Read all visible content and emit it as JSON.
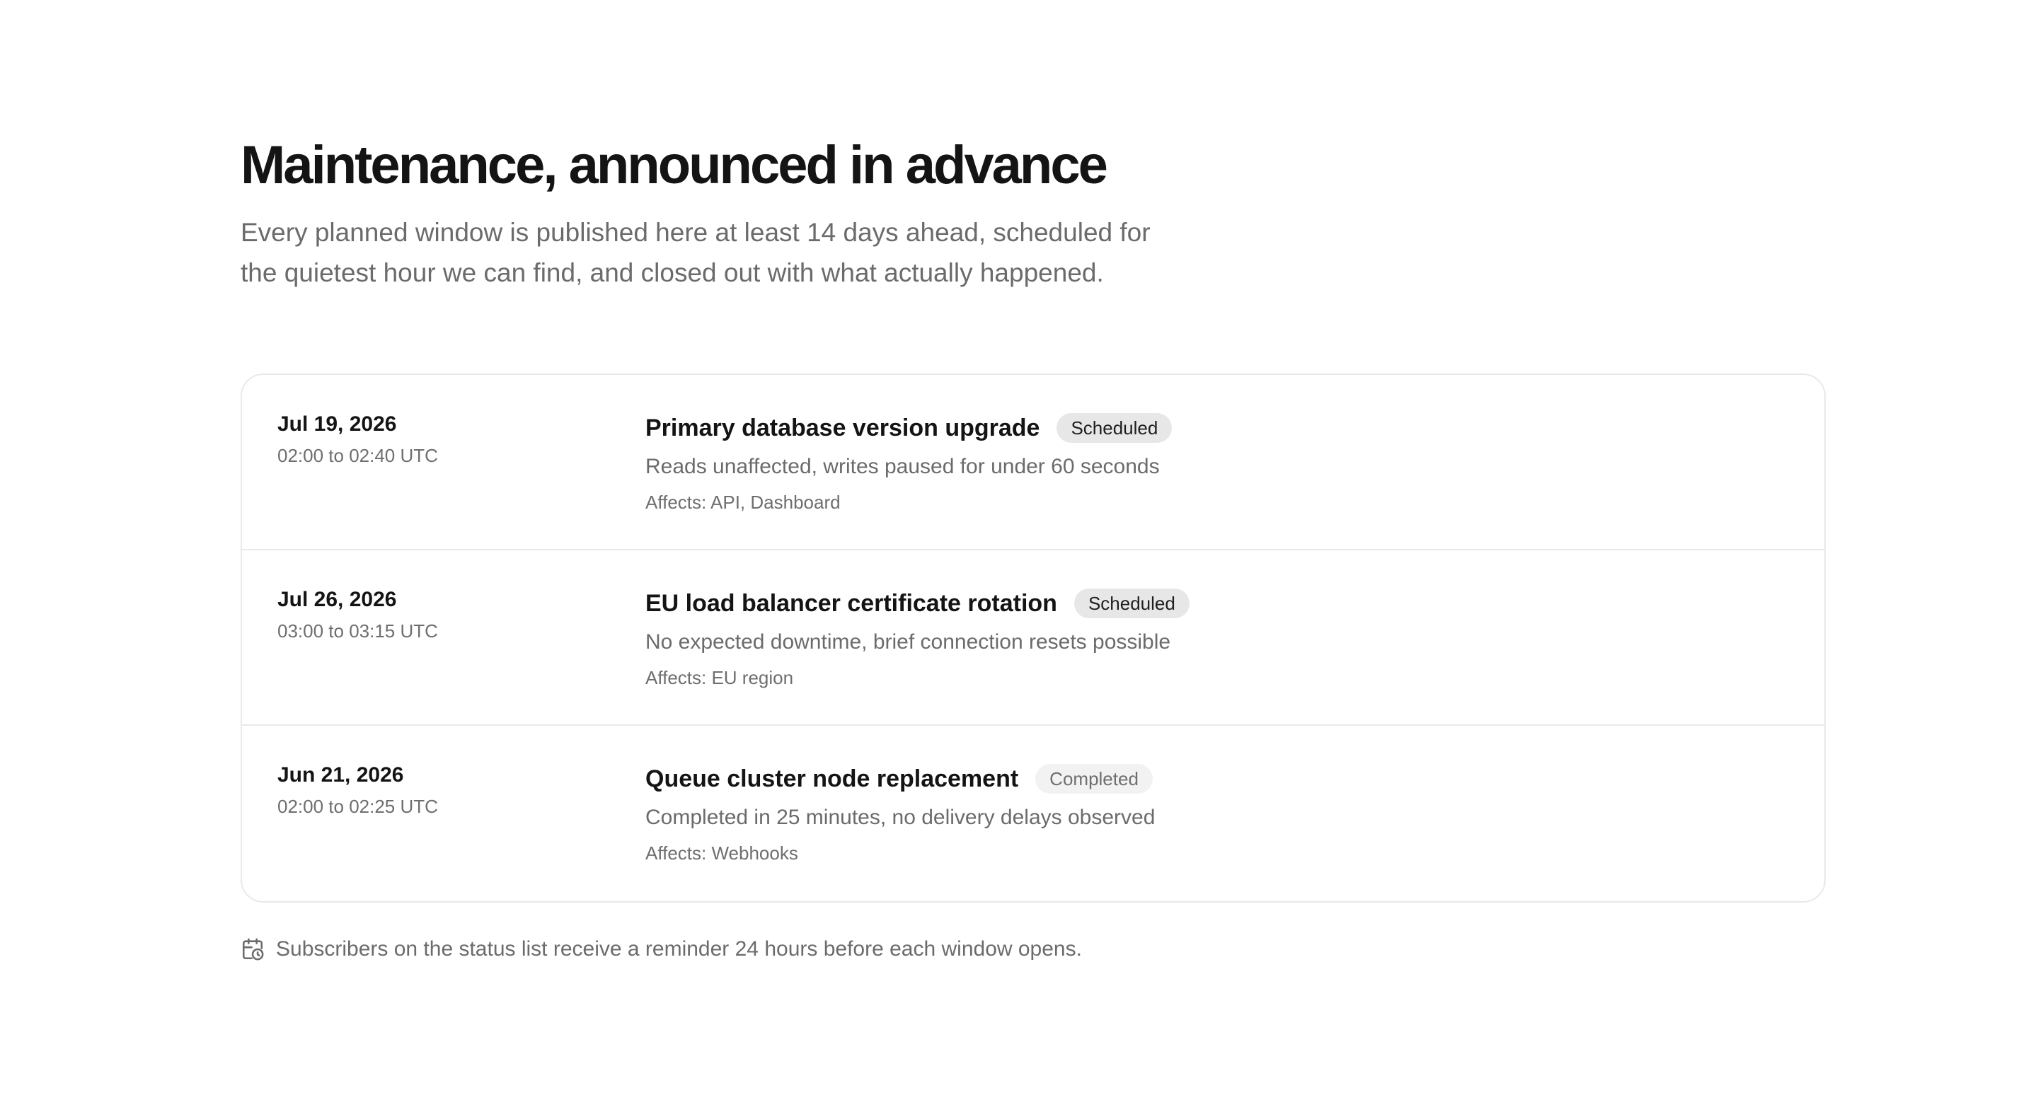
{
  "header": {
    "title": "Maintenance, announced in advance",
    "intro_line1": "Every planned window is published here at least 14 days ahead, scheduled for",
    "intro_line2": "the quietest hour we can find, and closed out with what actually happened."
  },
  "maintenance": [
    {
      "date": "Jul 19, 2026",
      "time": "02:00 to 02:40 UTC",
      "title": "Primary database version upgrade",
      "status": "Scheduled",
      "summary": "Reads unaffected, writes paused for under 60 seconds",
      "affects": "Affects: API, Dashboard"
    },
    {
      "date": "Jul 26, 2026",
      "time": "03:00 to 03:15 UTC",
      "title": "EU load balancer certificate rotation",
      "status": "Scheduled",
      "summary": "No expected downtime, brief connection resets possible",
      "affects": "Affects: EU region"
    },
    {
      "date": "Jun 21, 2026",
      "time": "02:00 to 02:25 UTC",
      "title": "Queue cluster node replacement",
      "status": "Completed",
      "summary": "Completed in 25 minutes, no delivery delays observed",
      "affects": "Affects: Webhooks"
    }
  ],
  "footnote": {
    "icon": "calendar-clock-icon",
    "text": "Subscribers on the status list receive a reminder 24 hours before each window opens."
  },
  "colors": {
    "text_primary": "#141414",
    "text_secondary": "#6b6b6b",
    "border": "#e9e9e9",
    "badge_scheduled_bg": "#e7e7e7",
    "badge_completed_bg": "#f2f2f2"
  }
}
